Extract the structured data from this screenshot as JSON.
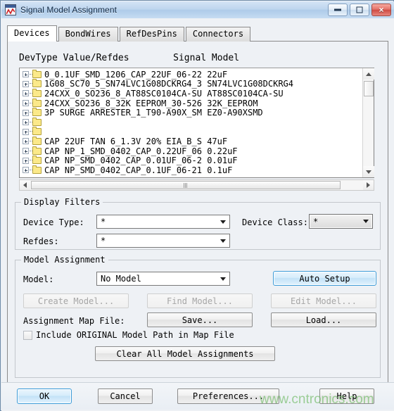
{
  "window": {
    "title": "Signal Model Assignment",
    "app_icon": "signal-waveform-icon",
    "buttons": {
      "minimize": "minimize-icon",
      "maximize": "maximize-icon",
      "close": "×"
    }
  },
  "tabs": [
    {
      "label": "Devices",
      "active": true
    },
    {
      "label": "BondWires",
      "active": false
    },
    {
      "label": "RefDesPins",
      "active": false
    },
    {
      "label": "Connectors",
      "active": false
    }
  ],
  "list": {
    "header": "DevType Value/Refdes        Signal Model",
    "rows": [
      {
        "left": "0_0.1UF_SMD_1206_CAP_22UF_06-22",
        "model": "22uF"
      },
      {
        "left": "1G08_SC70_5_SN74LVC1G08DCKRG4_3",
        "model": "SN74LVC1G08DCKRG4"
      },
      {
        "left": "24CXX_0_SO236_8_AT88SC0104CA-SU",
        "model": "AT88SC0104CA-SU"
      },
      {
        "left": "24CXX_SO236_8_32K EEPROM_30-526",
        "model": "32K_EEPROM"
      },
      {
        "left": "3P SURGE ARRESTER_1_T90-A90X_SM",
        "model": "EZ0-A90XSMD"
      },
      {
        "left": "",
        "model": ""
      },
      {
        "left": "",
        "model": ""
      },
      {
        "left": "CAP 22UF TAN 6_1.3V 20% EIA_B_S",
        "model": "47uF"
      },
      {
        "left": "CAP NP_1_SMD_0402_CAP_0.22UF_06",
        "model": "0.22uF"
      },
      {
        "left": "CAP NP_SMD_0402_CAP_0.01UF_06-2",
        "model": "0.01uF"
      },
      {
        "left": "CAP NP_SMD_0402_CAP_0.1UF_06-21",
        "model": "0.1uF"
      }
    ],
    "scroll": {
      "v_up": "scroll-up-arrow",
      "v_down": "scroll-down-arrow",
      "h_left": "scroll-left-arrow",
      "h_right": "scroll-right-arrow"
    }
  },
  "display_filters": {
    "legend": "Display Filters",
    "device_type_label": "Device Type:",
    "device_type_value": "*",
    "device_class_label": "Device Class:",
    "device_class_value": "*",
    "refdes_label": "Refdes:",
    "refdes_value": "*"
  },
  "model_assignment": {
    "legend": "Model Assignment",
    "model_label": "Model:",
    "model_value": "No Model",
    "auto_setup": "Auto Setup",
    "create_model": "Create Model...",
    "find_model": "Find Model...",
    "edit_model": "Edit Model...",
    "map_file_label": "Assignment Map File:",
    "save": "Save...",
    "load": "Load...",
    "include_original_label": "Include ORIGINAL Model Path in Map File",
    "include_original_checked": false,
    "clear_all": "Clear All Model Assignments"
  },
  "footer": {
    "ok": "OK",
    "cancel": "Cancel",
    "preferences": "Preferences...",
    "help": "Help"
  },
  "watermark": "www.cntronics.com",
  "colors": {
    "title_bar": "#bed5ee",
    "close_button": "#cf4c44",
    "default_button_border": "#3c9bd8",
    "folder": "#fbe98a",
    "watermark": "#78be6e"
  }
}
